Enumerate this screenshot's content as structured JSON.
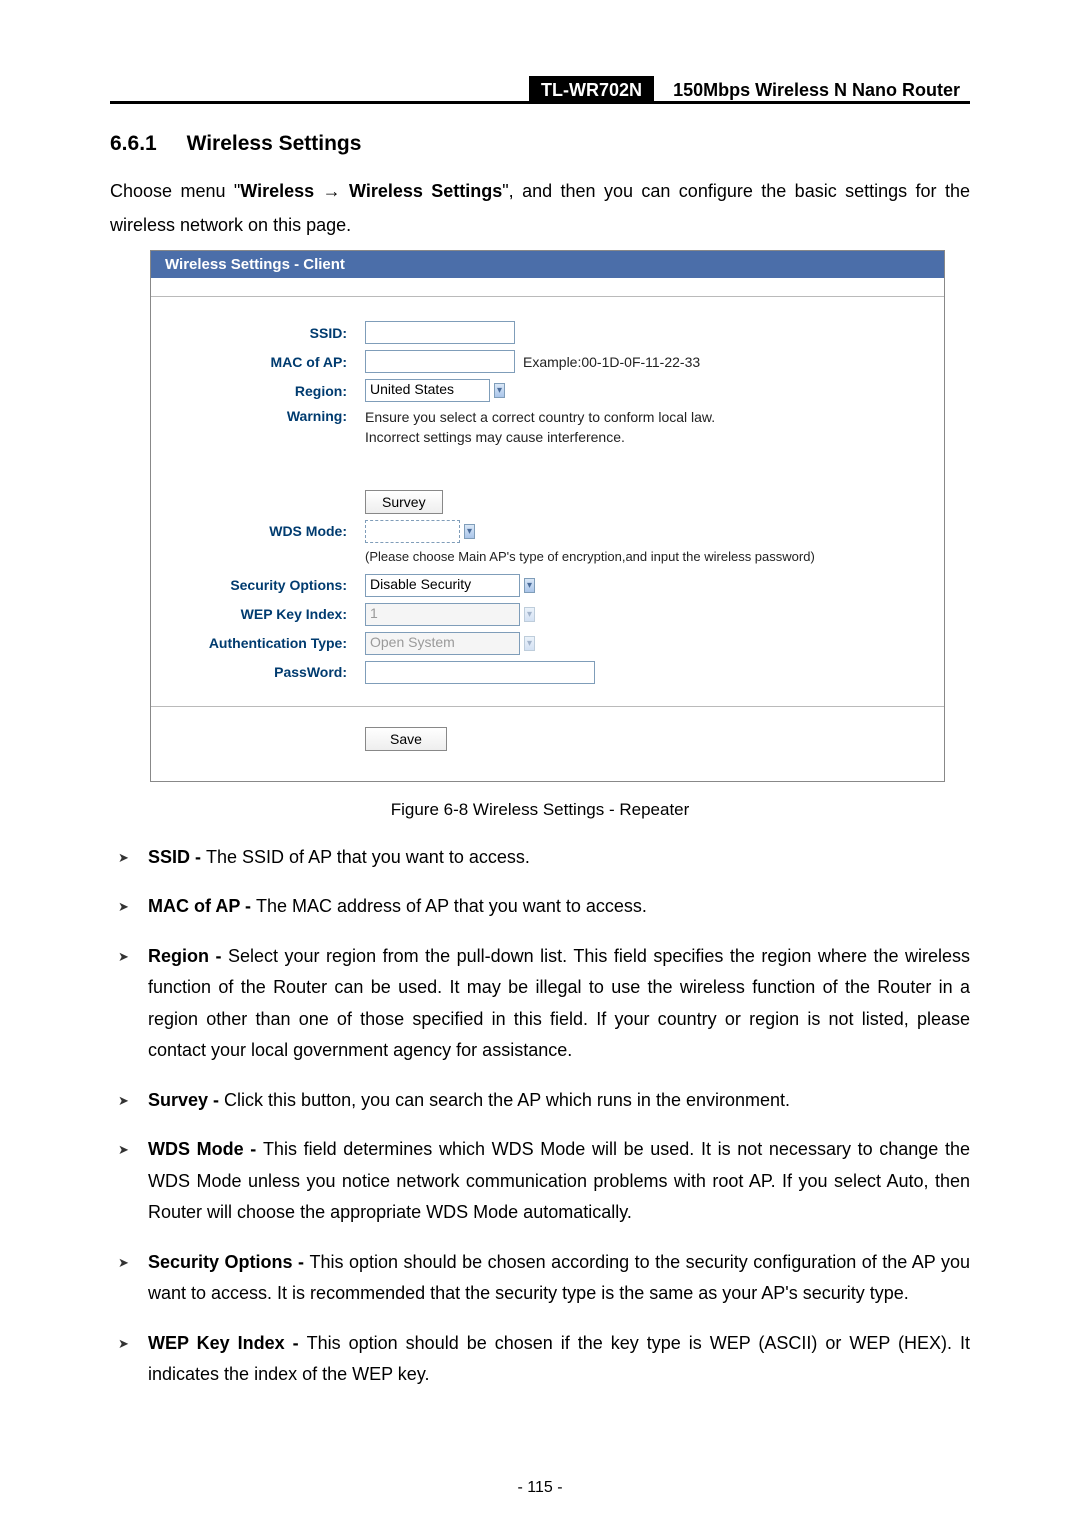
{
  "header": {
    "model": "TL-WR702N",
    "desc": "150Mbps Wireless N Nano Router"
  },
  "section": {
    "number": "6.6.1",
    "title": "Wireless Settings",
    "intro_prefix": "Choose menu \"",
    "intro_bold1": "Wireless",
    "intro_arrow": " → ",
    "intro_bold2": "Wireless Settings",
    "intro_suffix": "\", and then you can configure the basic settings for the wireless network on this page."
  },
  "screenshot": {
    "title": "Wireless Settings - Client",
    "labels": {
      "ssid": "SSID:",
      "mac": "MAC of AP:",
      "region": "Region:",
      "warning": "Warning:",
      "wds": "WDS Mode:",
      "sec": "Security Options:",
      "wep": "WEP Key Index:",
      "auth": "Authentication Type:",
      "pass": "PassWord:"
    },
    "values": {
      "ssid": "",
      "mac": "",
      "mac_example": "Example:00-1D-0F-11-22-33",
      "region": "United States",
      "warning_line1": "Ensure you select a correct country to conform local law.",
      "warning_line2": "Incorrect settings may cause interference.",
      "survey_btn": "Survey",
      "wds": "",
      "wds_hint": "(Please choose Main AP's type of encryption,and input the wireless password)",
      "sec": "Disable Security",
      "wep": "1",
      "auth": "Open System",
      "pass": "",
      "save_btn": "Save"
    }
  },
  "caption": "Figure 6-8 Wireless Settings - Repeater",
  "bullets": [
    {
      "term": "SSID - ",
      "text": "The SSID of AP that you want to access."
    },
    {
      "term": "MAC of AP - ",
      "text": "The MAC address of AP that you want to access."
    },
    {
      "term": "Region - ",
      "text": "Select your region from the pull-down list. This field specifies the region where the wireless function of the Router can be used. It may be illegal to use the wireless function of the Router in a region other than one of those specified in this field. If your country or region is not listed, please contact your local government agency for assistance."
    },
    {
      "term": "Survey - ",
      "text": "Click this button, you can search the AP which runs in the environment."
    },
    {
      "term": "WDS Mode - ",
      "text": "This field determines which WDS Mode will be used. It is not necessary to change the WDS Mode unless you notice network communication problems with root AP. If you select Auto, then Router will choose the appropriate WDS Mode automatically."
    },
    {
      "term": "Security Options - ",
      "text": "This option should be chosen according to the security configuration of the AP you want to access. It is recommended that the security type is the same as your AP's security type."
    },
    {
      "term": "WEP Key Index - ",
      "text": "This option should be chosen if the key type is WEP (ASCII) or WEP (HEX). It indicates the index of the WEP key."
    }
  ],
  "page_number": "- 115 -"
}
